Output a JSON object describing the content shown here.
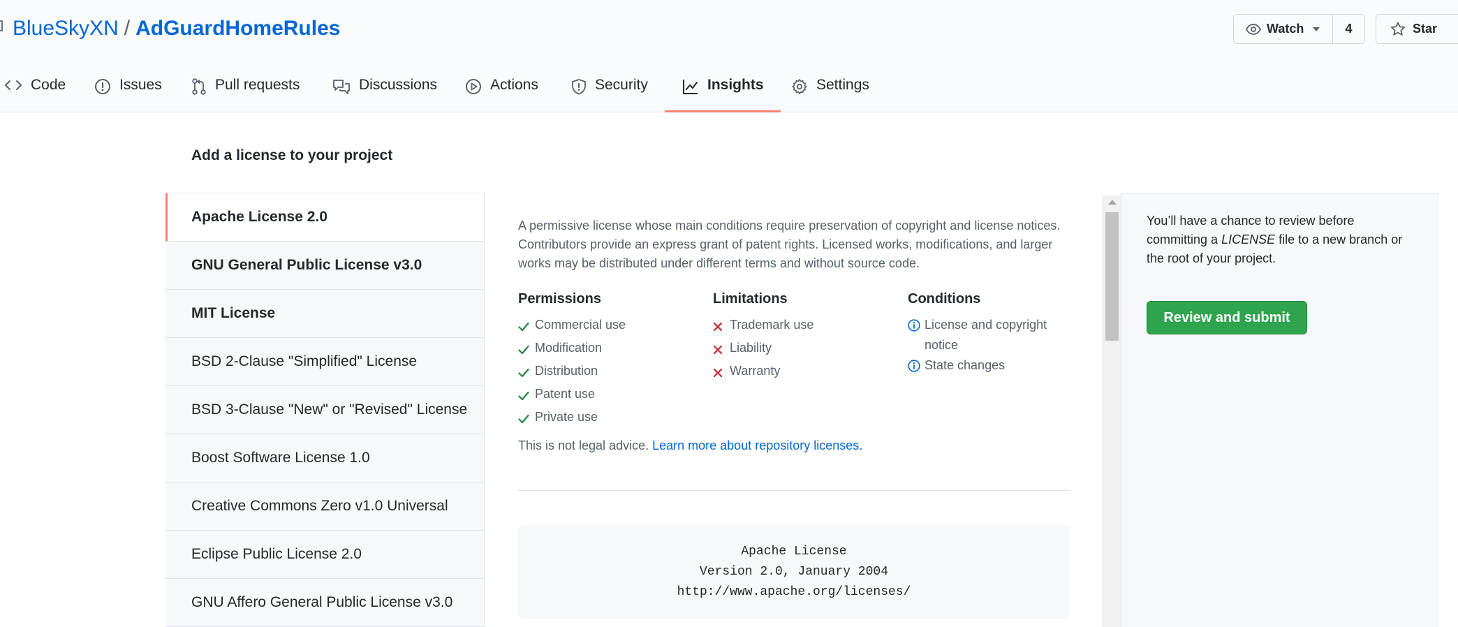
{
  "repo": {
    "owner": "BlueSkyXN",
    "separator": "/",
    "name": "AdGuardHomeRules"
  },
  "header_actions": {
    "watch_label": "Watch",
    "watch_count": "4",
    "star_label": "Star"
  },
  "tabs": [
    {
      "label": "Code",
      "icon": "code-icon"
    },
    {
      "label": "Issues",
      "icon": "issue-icon"
    },
    {
      "label": "Pull requests",
      "icon": "pull-request-icon"
    },
    {
      "label": "Discussions",
      "icon": "discussion-icon"
    },
    {
      "label": "Actions",
      "icon": "play-icon"
    },
    {
      "label": "Security",
      "icon": "shield-icon"
    },
    {
      "label": "Insights",
      "icon": "graph-icon",
      "active": true
    },
    {
      "label": "Settings",
      "icon": "gear-icon"
    }
  ],
  "page_heading": "Add a license to your project",
  "licenses": [
    {
      "label": "Apache License 2.0",
      "selected": true,
      "bold": true
    },
    {
      "label": "GNU General Public License v3.0",
      "bold": true
    },
    {
      "label": "MIT License",
      "bold": true
    },
    {
      "label": "BSD 2-Clause \"Simplified\" License"
    },
    {
      "label": "BSD 3-Clause \"New\" or \"Revised\" License"
    },
    {
      "label": "Boost Software License 1.0"
    },
    {
      "label": "Creative Commons Zero v1.0 Universal"
    },
    {
      "label": "Eclipse Public License 2.0"
    },
    {
      "label": "GNU Affero General Public License v3.0"
    }
  ],
  "license_detail": {
    "description": "A permissive license whose main conditions require preservation of copyright and license notices. Contributors provide an express grant of patent rights. Licensed works, modifications, and larger works may be distributed under different terms and without source code.",
    "permissions": {
      "heading": "Permissions",
      "items": [
        "Commercial use",
        "Modification",
        "Distribution",
        "Patent use",
        "Private use"
      ]
    },
    "limitations": {
      "heading": "Limitations",
      "items": [
        "Trademark use",
        "Liability",
        "Warranty"
      ]
    },
    "conditions": {
      "heading": "Conditions",
      "items": [
        "License and copyright notice",
        "State changes"
      ]
    },
    "disclaimer_text": "This is not legal advice.",
    "disclaimer_link": "Learn more about repository licenses.",
    "license_text_line1": "Apache License",
    "license_text_line2": "Version 2.0, January 2004",
    "license_text_line3": "http://www.apache.org/licenses/"
  },
  "sidebar": {
    "note_before": "You’ll have a chance to review before committing a",
    "note_file": "LICENSE",
    "note_after": "file to a new branch or the root of your project.",
    "review_button": "Review and submit"
  },
  "colors": {
    "accent_link": "#0366d6",
    "active_tab_underline": "#f9826c",
    "primary_button": "#2ea44f",
    "check_green": "#22863a",
    "cross_red": "#cb2431",
    "info_blue": "#0366d6"
  }
}
